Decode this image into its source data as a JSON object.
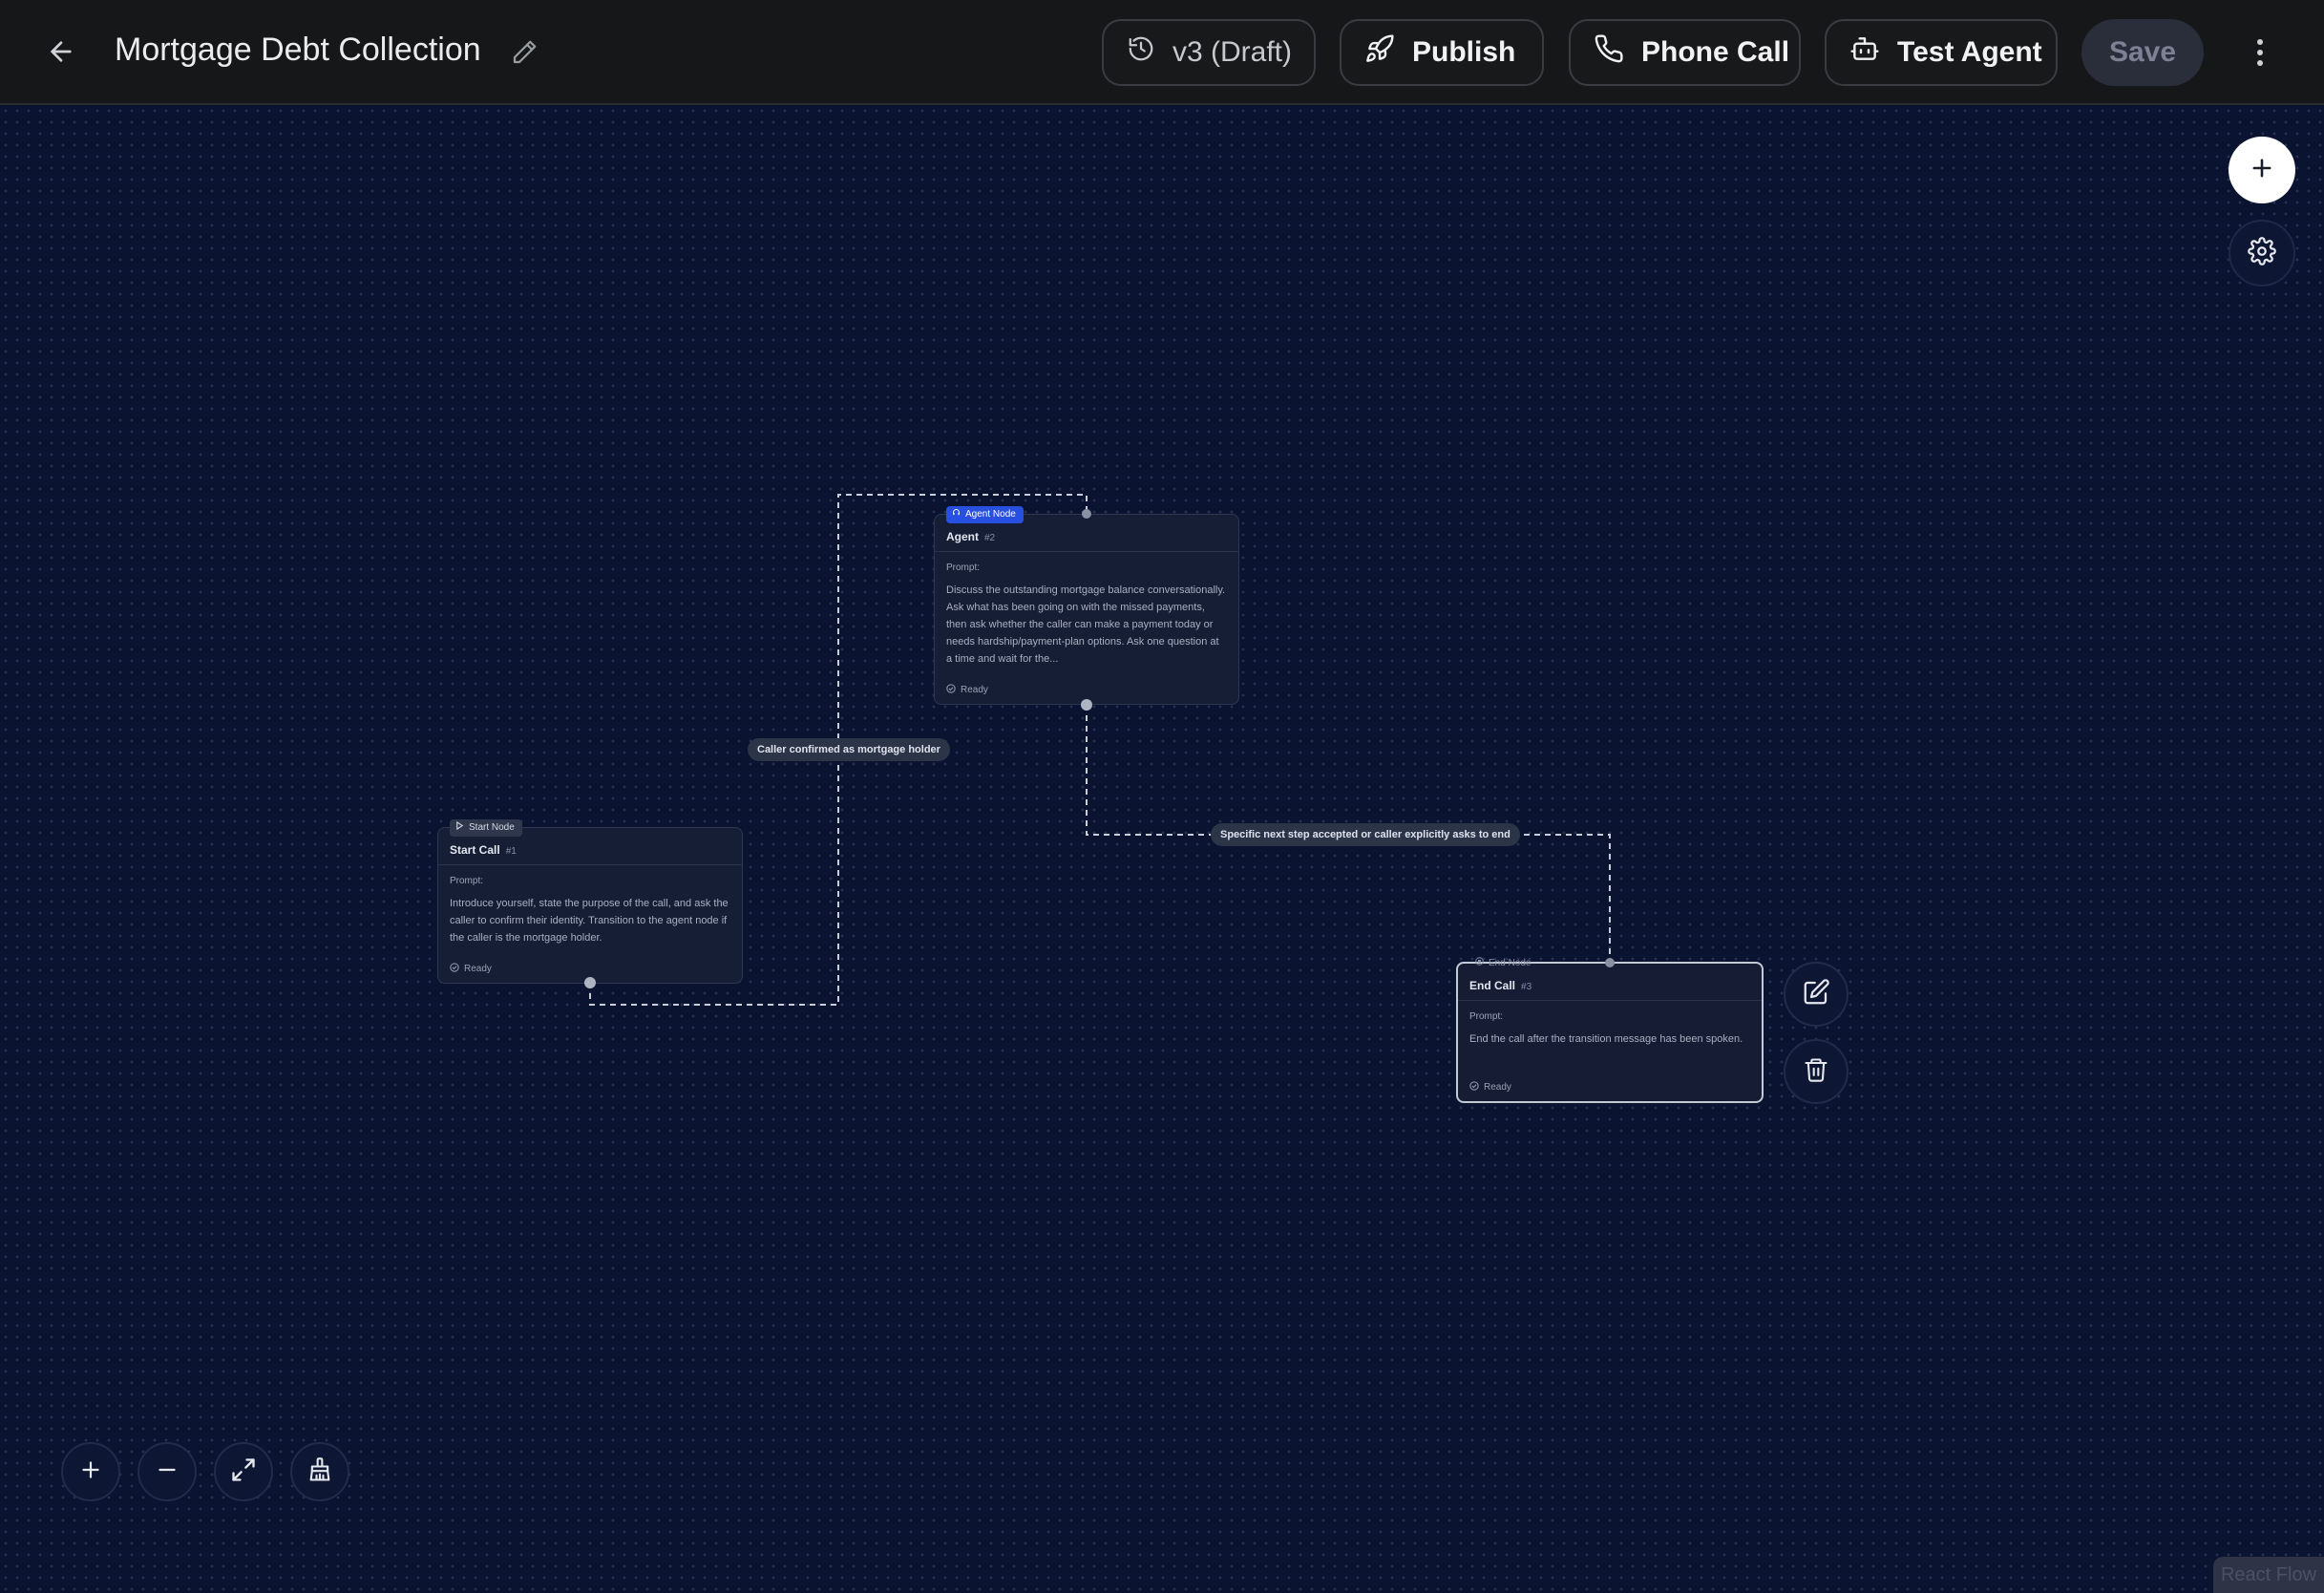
{
  "header": {
    "title": "Mortgage Debt Collection",
    "version_label": "v3 (Draft)",
    "publish_label": "Publish",
    "phone_call_label": "Phone Call",
    "test_agent_label": "Test Agent",
    "save_label": "Save"
  },
  "nodes": [
    {
      "badge": "Start Node",
      "title": "Start Call",
      "number": "#1",
      "prompt_label": "Prompt:",
      "prompt": "Introduce yourself, state the purpose of the call, and ask the caller to confirm their identity. Transition to the agent node if the caller is the mortgage holder.",
      "status": "Ready"
    },
    {
      "badge": "Agent Node",
      "title": "Agent",
      "number": "#2",
      "prompt_label": "Prompt:",
      "prompt": "Discuss the outstanding mortgage balance conversationally. Ask what has been going on with the missed payments, then ask whether the caller can make a payment today or needs hardship/payment-plan options. Ask one question at a time and wait for the...",
      "status": "Ready"
    },
    {
      "badge": "End Node",
      "title": "End Call",
      "number": "#3",
      "prompt_label": "Prompt:",
      "prompt": "End the call after the transition message has been spoken.",
      "status": "Ready"
    }
  ],
  "edges": [
    {
      "label": "Caller confirmed as mortgage holder"
    },
    {
      "label": "Specific next step accepted or caller explicitly asks to end"
    }
  ],
  "attribution": "React Flow",
  "colors": {
    "canvas": "#0a1330",
    "topbar": "#161719",
    "agent_badge": "#2750e0",
    "node_bg": "#161e35"
  }
}
